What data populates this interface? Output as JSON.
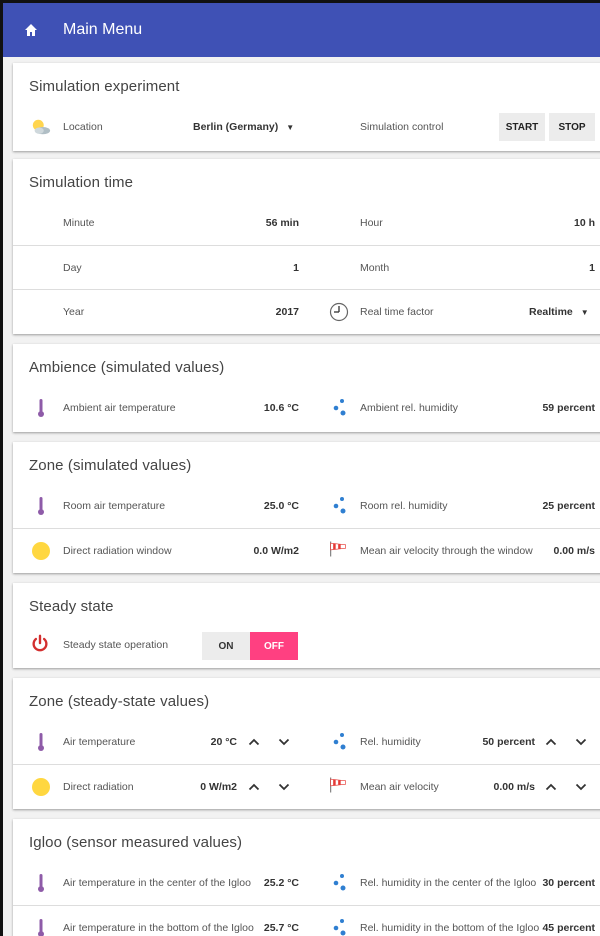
{
  "app": {
    "title": "Main Menu"
  },
  "experiment": {
    "title": "Simulation experiment",
    "location_label": "Location",
    "location_value": "Berlin (Germany)",
    "control_label": "Simulation control",
    "start_label": "START",
    "stop_label": "STOP"
  },
  "time": {
    "title": "Simulation time",
    "minute_label": "Minute",
    "minute_value": "56 min",
    "hour_label": "Hour",
    "hour_value": "10 h",
    "day_label": "Day",
    "day_value": "1",
    "month_label": "Month",
    "month_value": "1",
    "year_label": "Year",
    "year_value": "2017",
    "rtf_label": "Real time factor",
    "rtf_value": "Realtime"
  },
  "ambience": {
    "title": "Ambience (simulated values)",
    "temp_label": "Ambient air temperature",
    "temp_value": "10.6 °C",
    "hum_label": "Ambient rel. humidity",
    "hum_value": "59 percent"
  },
  "zone": {
    "title": "Zone (simulated values)",
    "temp_label": "Room air temperature",
    "temp_value": "25.0 °C",
    "hum_label": "Room rel. humidity",
    "hum_value": "25 percent",
    "rad_label": "Direct radiation window",
    "rad_value": "0.0 W/m2",
    "vel_label": "Mean air velocity through the window",
    "vel_value": "0.00 m/s"
  },
  "steady": {
    "title": "Steady state",
    "op_label": "Steady state operation",
    "on_label": "ON",
    "off_label": "OFF"
  },
  "zone_ss": {
    "title": "Zone (steady-state values)",
    "temp_label": "Air temperature",
    "temp_value": "20 °C",
    "hum_label": "Rel. humidity",
    "hum_value": "50 percent",
    "rad_label": "Direct radiation",
    "rad_value": "0 W/m2",
    "vel_label": "Mean air velocity",
    "vel_value": "0.00 m/s"
  },
  "igloo": {
    "title": "Igloo (sensor measured values)",
    "temp_center_label": "Air temperature in the center of the Igloo",
    "temp_center_value": "25.2 °C",
    "hum_center_label": "Rel. humidity in the center of the Igloo",
    "hum_center_value": "30 percent",
    "temp_bottom_label": "Air temperature in the bottom of the Igloo",
    "temp_bottom_value": "25.7 °C",
    "hum_bottom_label": "Rel. humidity in the bottom of the Igloo",
    "hum_bottom_value": "45 percent"
  },
  "colors": {
    "appbar": "#3f51b5",
    "accent": "#ff4081",
    "thermometer": "#8e5ba8",
    "humidity": "#2f7fd1",
    "sun": "#ffd740",
    "power": "#d32f2f"
  }
}
